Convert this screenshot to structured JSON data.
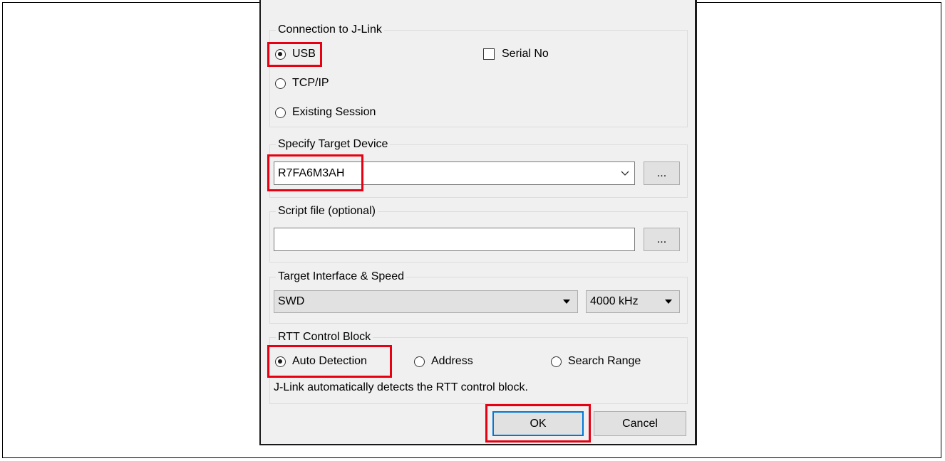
{
  "connection": {
    "title": "Connection to J-Link",
    "options": [
      "USB",
      "TCP/IP",
      "Existing Session"
    ],
    "selected": "USB",
    "serial_label": "Serial No",
    "serial_checked": false
  },
  "target_device": {
    "title": "Specify Target Device",
    "value": "R7FA6M3AH",
    "browse_label": "..."
  },
  "script_file": {
    "title": "Script file (optional)",
    "value": "",
    "browse_label": "..."
  },
  "interface": {
    "title": "Target Interface & Speed",
    "interface_value": "SWD",
    "speed_value": "4000 kHz"
  },
  "rtt": {
    "title": "RTT Control Block",
    "options": [
      "Auto Detection",
      "Address",
      "Search Range"
    ],
    "selected": "Auto Detection",
    "description": "J-Link automatically detects the RTT control block."
  },
  "buttons": {
    "ok_label": "OK",
    "cancel_label": "Cancel"
  },
  "colors": {
    "highlight": "#e60012",
    "dialog_bg": "#f0f0f0",
    "default_button_border": "#0078d7"
  },
  "icons": {
    "combo_arrow": "chevron-down-icon",
    "dropdown_arrow": "triangle-down-icon"
  }
}
